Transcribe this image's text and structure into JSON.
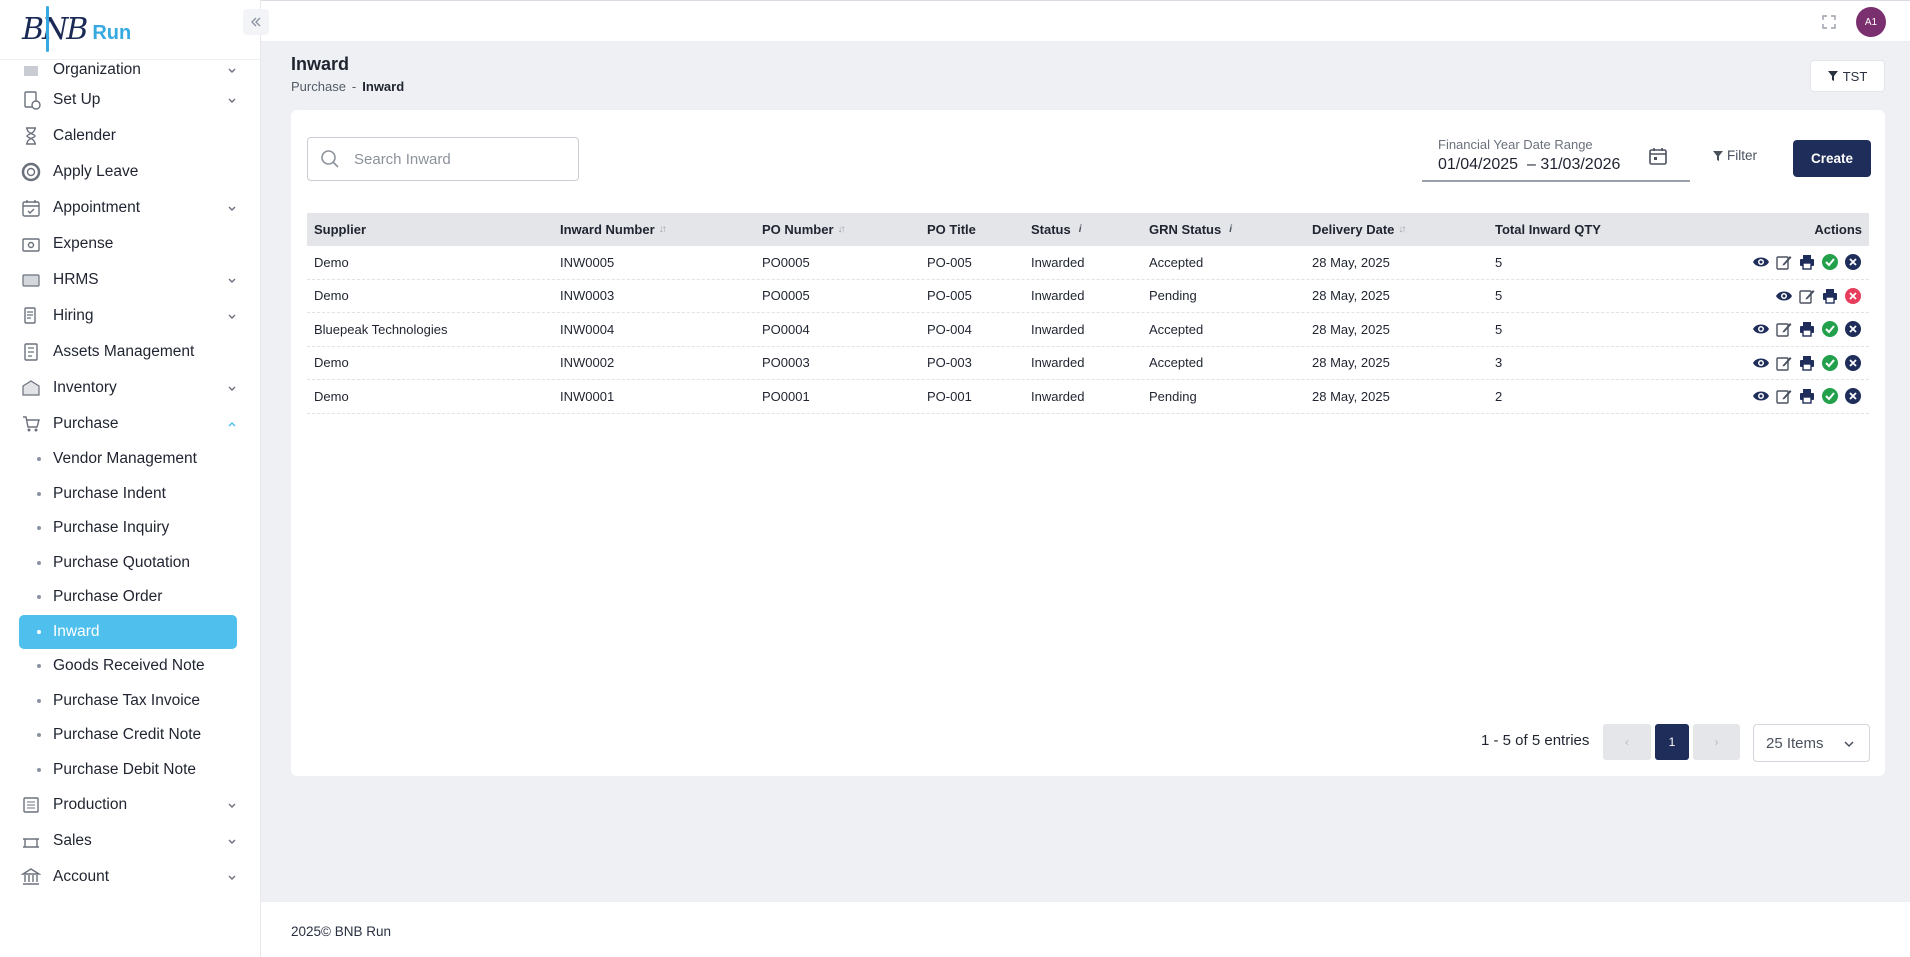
{
  "app": {
    "logo_text": "BNB",
    "logo_sub": "Run"
  },
  "sidebar": {
    "items": [
      {
        "label": "Organization",
        "icon": "organization-icon",
        "chevron": true
      },
      {
        "label": "Set Up",
        "icon": "setup-icon",
        "chevron": true
      },
      {
        "label": "Calender",
        "icon": "hourglass-icon",
        "chevron": false
      },
      {
        "label": "Apply Leave",
        "icon": "lifebuoy-icon",
        "chevron": false
      },
      {
        "label": "Appointment",
        "icon": "calendar-check-icon",
        "chevron": true
      },
      {
        "label": "Expense",
        "icon": "expense-icon",
        "chevron": false
      },
      {
        "label": "HRMS",
        "icon": "hrms-icon",
        "chevron": true
      },
      {
        "label": "Hiring",
        "icon": "hiring-icon",
        "chevron": true
      },
      {
        "label": "Assets Management",
        "icon": "assets-icon",
        "chevron": false
      },
      {
        "label": "Inventory",
        "icon": "inventory-icon",
        "chevron": true
      },
      {
        "label": "Purchase",
        "icon": "cart-icon",
        "chevron": true,
        "expanded": true
      }
    ],
    "purchase_sub": [
      "Vendor Management",
      "Purchase Indent",
      "Purchase Inquiry",
      "Purchase Quotation",
      "Purchase Order",
      "Inward",
      "Goods Received Note",
      "Purchase Tax Invoice",
      "Purchase Credit Note",
      "Purchase Debit Note"
    ],
    "active_sub": "Inward",
    "bottom_items": [
      {
        "label": "Production",
        "icon": "factory-icon"
      },
      {
        "label": "Sales",
        "icon": "sales-icon"
      },
      {
        "label": "Account",
        "icon": "bank-icon"
      }
    ]
  },
  "topbar": {
    "avatar_initials": "A1"
  },
  "page": {
    "title": "Inward",
    "breadcrumb": {
      "parent": "Purchase",
      "sep": "-",
      "current": "Inward"
    },
    "tst_label": "TST"
  },
  "toolbar": {
    "search_placeholder": "Search Inward",
    "date_range_label": "Financial Year Date Range",
    "date_range_value": "01/04/2025  – 31/03/2026",
    "filter_label": "Filter",
    "create_label": "Create"
  },
  "table": {
    "columns": [
      "Supplier",
      "Inward Number",
      "PO Number",
      "PO Title",
      "Status",
      "GRN Status",
      "Delivery Date",
      "Total Inward QTY",
      "Actions"
    ],
    "rows": [
      {
        "supplier": "Demo",
        "inward": "INW0005",
        "po": "PO0005",
        "title": "PO-005",
        "status": "Inwarded",
        "grn": "Accepted",
        "date": "28 May, 2025",
        "qty": "5",
        "actions": [
          "view",
          "edit",
          "print",
          "approve",
          "reject"
        ]
      },
      {
        "supplier": "Demo",
        "inward": "INW0003",
        "po": "PO0005",
        "title": "PO-005",
        "status": "Inwarded",
        "grn": "Pending",
        "date": "28 May, 2025",
        "qty": "5",
        "actions": [
          "view",
          "edit",
          "print",
          "cancel"
        ]
      },
      {
        "supplier": "Bluepeak Technologies",
        "inward": "INW0004",
        "po": "PO0004",
        "title": "PO-004",
        "status": "Inwarded",
        "grn": "Accepted",
        "date": "28 May, 2025",
        "qty": "5",
        "actions": [
          "view",
          "edit",
          "print",
          "approve",
          "reject"
        ]
      },
      {
        "supplier": "Demo",
        "inward": "INW0002",
        "po": "PO0003",
        "title": "PO-003",
        "status": "Inwarded",
        "grn": "Accepted",
        "date": "28 May, 2025",
        "qty": "3",
        "actions": [
          "view",
          "edit",
          "print",
          "approve",
          "reject"
        ]
      },
      {
        "supplier": "Demo",
        "inward": "INW0001",
        "po": "PO0001",
        "title": "PO-001",
        "status": "Inwarded",
        "grn": "Pending",
        "date": "28 May, 2025",
        "qty": "2",
        "actions": [
          "view",
          "edit",
          "print",
          "approve",
          "reject"
        ]
      }
    ]
  },
  "pagination": {
    "entries_text": "1 - 5 of 5 entries",
    "prev": "‹",
    "current_page": "1",
    "next": "›",
    "per_page": "25 Items"
  },
  "footer": {
    "text": "2025© BNB Run"
  },
  "colors": {
    "primary": "#1e2d5a",
    "accent": "#4fc0ee",
    "approve": "#22a04b",
    "cancel": "#e63d5c"
  }
}
